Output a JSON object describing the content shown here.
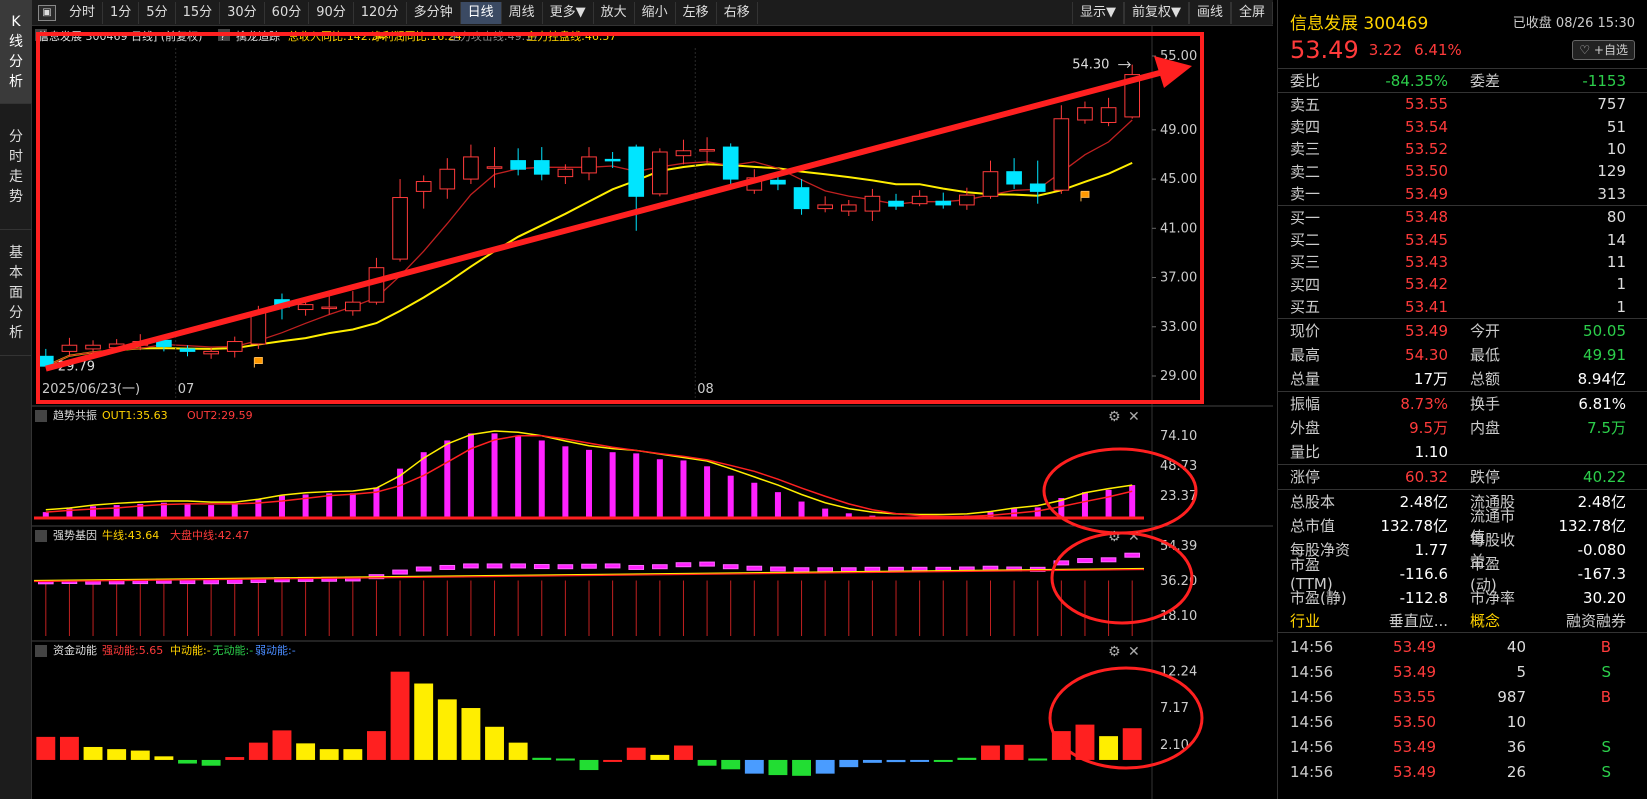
{
  "left_tabs": [
    "K线分析",
    "分时走势",
    "基本面分析"
  ],
  "toolbar": {
    "square_icon": "▣",
    "periods": [
      "分时",
      "1分",
      "5分",
      "15分",
      "30分",
      "60分",
      "90分",
      "120分",
      "多分钟",
      "日线",
      "周线",
      "更多▼",
      "放大",
      "缩小",
      "左移",
      "右移"
    ],
    "active": "日线",
    "right": [
      "显示▼",
      "前复权▼",
      "画线",
      "全屏"
    ]
  },
  "main_chart": {
    "title": "信息发展 300469 日线] (前复权)",
    "help": "?",
    "indicator": "擒龙追踪",
    "items": [
      {
        "label": "总收入同比:142.34",
        "color": "#ffd200"
      },
      {
        "label": "净利润同比:16.24",
        "color": "#ffd200"
      },
      {
        "label": "主力攻击线:49.17",
        "color": "#888888"
      },
      {
        "label": "主力控盘线:46.57",
        "color": "#ffd200"
      }
    ],
    "high_label": "54.30",
    "low_label": "29.79",
    "date_label": "2025/06/23(一)",
    "month_labels": [
      "07",
      "08"
    ],
    "y_ticks": [
      "55.00",
      "49.00",
      "45.00",
      "41.00",
      "37.00",
      "33.00",
      "29.00"
    ]
  },
  "panels": [
    {
      "name": "趋势共振",
      "items": [
        {
          "label": "OUT1:35.63",
          "color": "#ffd200"
        },
        {
          "label": "OUT2:29.59",
          "color": "#ff3b3b"
        }
      ],
      "y_ticks": [
        "74.10",
        "48.73",
        "23.37"
      ]
    },
    {
      "name": "强势基因",
      "items": [
        {
          "label": "牛线:43.64",
          "color": "#ffd200"
        },
        {
          "label": "大盘中线:42.47",
          "color": "#ff3b3b"
        }
      ],
      "y_ticks": [
        "54.39",
        "36.20",
        "18.10"
      ]
    },
    {
      "name": "资金动能",
      "items": [
        {
          "label": "强动能:5.65",
          "color": "#ff3b3b"
        },
        {
          "label": "中动能:-",
          "color": "#ffd200"
        },
        {
          "label": "无动能:-",
          "color": "#2ccf4b"
        },
        {
          "label": "弱动能:-",
          "color": "#4a8cff"
        }
      ],
      "y_ticks": [
        "12.24",
        "7.17",
        "2.10"
      ]
    }
  ],
  "panel_icons": {
    "gear": "⚙",
    "close": "✕"
  },
  "side": {
    "name": "信息发展 300469",
    "status": "已收盘 08/26 15:30",
    "price": "53.49",
    "change": "3.22",
    "pct": "6.41%",
    "watch_btn": "♡ +自选",
    "weibi": {
      "l1": "委比",
      "v1": "-84.35%",
      "l2": "委差",
      "v2": "-1153"
    },
    "asks": [
      {
        "label": "卖五",
        "price": "53.55",
        "vol": "757"
      },
      {
        "label": "卖四",
        "price": "53.54",
        "vol": "51"
      },
      {
        "label": "卖三",
        "price": "53.52",
        "vol": "10"
      },
      {
        "label": "卖二",
        "price": "53.50",
        "vol": "129"
      },
      {
        "label": "卖一",
        "price": "53.49",
        "vol": "313"
      }
    ],
    "bids": [
      {
        "label": "买一",
        "price": "53.48",
        "vol": "80"
      },
      {
        "label": "买二",
        "price": "53.45",
        "vol": "14"
      },
      {
        "label": "买三",
        "price": "53.43",
        "vol": "11"
      },
      {
        "label": "买四",
        "price": "53.42",
        "vol": "1"
      },
      {
        "label": "买五",
        "price": "53.41",
        "vol": "1"
      }
    ],
    "stats1": [
      {
        "l1": "现价",
        "v1": "53.49",
        "c1": "red",
        "l2": "今开",
        "v2": "50.05",
        "c2": "green"
      },
      {
        "l1": "最高",
        "v1": "54.30",
        "c1": "red",
        "l2": "最低",
        "v2": "49.91",
        "c2": "green"
      },
      {
        "l1": "总量",
        "v1": "17万",
        "c1": "white",
        "l2": "总额",
        "v2": "8.94亿",
        "c2": "white"
      }
    ],
    "stats2": [
      {
        "l1": "振幅",
        "v1": "8.73%",
        "c1": "red",
        "l2": "换手",
        "v2": "6.81%",
        "c2": "white"
      },
      {
        "l1": "外盘",
        "v1": "9.5万",
        "c1": "red",
        "l2": "内盘",
        "v2": "7.5万",
        "c2": "green"
      },
      {
        "l1": "量比",
        "v1": "1.10",
        "c1": "white",
        "l2": "",
        "v2": "",
        "c2": "white"
      }
    ],
    "stats3": [
      {
        "l1": "涨停",
        "v1": "60.32",
        "c1": "red",
        "l2": "跌停",
        "v2": "40.22",
        "c2": "green"
      }
    ],
    "stats4": [
      {
        "l1": "总股本",
        "v1": "2.48亿",
        "c1": "white",
        "l2": "流通股",
        "v2": "2.48亿",
        "c2": "white"
      },
      {
        "l1": "总市值",
        "v1": "132.78亿",
        "c1": "white",
        "l2": "流通市值",
        "v2": "132.78亿",
        "c2": "white"
      },
      {
        "l1": "每股净资",
        "v1": "1.77",
        "c1": "white",
        "l2": "每股收益",
        "v2": "-0.080",
        "c2": "white"
      },
      {
        "l1": "市盈(TTM)",
        "v1": "-116.6",
        "c1": "white",
        "l2": "市盈(动)",
        "v2": "-167.3",
        "c2": "white"
      },
      {
        "l1": "市盈(静)",
        "v1": "-112.8",
        "c1": "white",
        "l2": "市净率",
        "v2": "30.20",
        "c2": "white"
      }
    ],
    "industry": {
      "label": "行业",
      "value": "垂直应...",
      "concept": "概念",
      "margin": "融资融券"
    },
    "ticks": [
      {
        "time": "14:56",
        "price": "53.49",
        "vol": "40",
        "dir": "B"
      },
      {
        "time": "14:56",
        "price": "53.49",
        "vol": "5",
        "dir": "S"
      },
      {
        "time": "14:56",
        "price": "53.55",
        "vol": "987",
        "dir": "B"
      },
      {
        "time": "14:56",
        "price": "53.50",
        "vol": "10",
        "dir": ""
      },
      {
        "time": "14:56",
        "price": "53.49",
        "vol": "36",
        "dir": "S"
      },
      {
        "time": "14:56",
        "price": "53.49",
        "vol": "26",
        "dir": "S"
      }
    ]
  },
  "chart_data": [
    {
      "type": "candlestick",
      "ylim": [
        29,
        55
      ],
      "candles": [
        {
          "o": 30.6,
          "c": 29.8,
          "h": 31.2,
          "l": 29.8
        },
        {
          "o": 31.0,
          "c": 31.5,
          "h": 32.1,
          "l": 30.6
        },
        {
          "o": 31.2,
          "c": 31.5,
          "h": 31.9,
          "l": 30.9
        },
        {
          "o": 31.3,
          "c": 31.6,
          "h": 32.0,
          "l": 31.0
        },
        {
          "o": 31.5,
          "c": 31.8,
          "h": 32.4,
          "l": 31.1
        },
        {
          "o": 31.9,
          "c": 31.4,
          "h": 32.2,
          "l": 31.0
        },
        {
          "o": 31.2,
          "c": 31.0,
          "h": 31.5,
          "l": 30.6
        },
        {
          "o": 30.8,
          "c": 31.0,
          "h": 31.3,
          "l": 30.4
        },
        {
          "o": 31.0,
          "c": 31.8,
          "h": 32.2,
          "l": 30.5
        },
        {
          "o": 31.6,
          "c": 34.2,
          "h": 34.7,
          "l": 31.2
        },
        {
          "o": 35.2,
          "c": 34.6,
          "h": 35.7,
          "l": 33.6
        },
        {
          "o": 34.4,
          "c": 34.8,
          "h": 35.3,
          "l": 33.9
        },
        {
          "o": 34.6,
          "c": 34.6,
          "h": 35.5,
          "l": 34.0
        },
        {
          "o": 34.3,
          "c": 35.0,
          "h": 35.9,
          "l": 33.9
        },
        {
          "o": 35.0,
          "c": 37.8,
          "h": 38.6,
          "l": 34.8
        },
        {
          "o": 38.5,
          "c": 43.5,
          "h": 45.0,
          "l": 38.3
        },
        {
          "o": 44.0,
          "c": 44.8,
          "h": 45.3,
          "l": 42.6
        },
        {
          "o": 44.2,
          "c": 45.8,
          "h": 46.7,
          "l": 43.4
        },
        {
          "o": 45.0,
          "c": 46.8,
          "h": 47.8,
          "l": 44.6
        },
        {
          "o": 46.0,
          "c": 46.0,
          "h": 47.6,
          "l": 44.3
        },
        {
          "o": 46.5,
          "c": 45.8,
          "h": 47.5,
          "l": 45.3
        },
        {
          "o": 46.5,
          "c": 45.4,
          "h": 47.6,
          "l": 44.9
        },
        {
          "o": 45.2,
          "c": 45.8,
          "h": 46.2,
          "l": 44.6
        },
        {
          "o": 45.5,
          "c": 46.8,
          "h": 47.6,
          "l": 44.9
        },
        {
          "o": 46.6,
          "c": 46.5,
          "h": 47.2,
          "l": 45.9
        },
        {
          "o": 47.6,
          "c": 43.6,
          "h": 47.8,
          "l": 40.8
        },
        {
          "o": 43.8,
          "c": 47.2,
          "h": 47.5,
          "l": 43.6
        },
        {
          "o": 46.9,
          "c": 47.3,
          "h": 48.2,
          "l": 46.2
        },
        {
          "o": 47.4,
          "c": 47.4,
          "h": 48.4,
          "l": 46.2
        },
        {
          "o": 47.6,
          "c": 45.0,
          "h": 47.9,
          "l": 44.5
        },
        {
          "o": 44.1,
          "c": 45.1,
          "h": 45.8,
          "l": 43.8
        },
        {
          "o": 44.9,
          "c": 44.6,
          "h": 45.3,
          "l": 44.1
        },
        {
          "o": 44.3,
          "c": 42.6,
          "h": 45.0,
          "l": 42.1
        },
        {
          "o": 42.6,
          "c": 42.9,
          "h": 43.6,
          "l": 42.3
        },
        {
          "o": 42.4,
          "c": 42.9,
          "h": 43.3,
          "l": 42.0
        },
        {
          "o": 42.4,
          "c": 43.6,
          "h": 44.2,
          "l": 41.6
        },
        {
          "o": 43.2,
          "c": 42.8,
          "h": 43.8,
          "l": 42.5
        },
        {
          "o": 43.0,
          "c": 43.6,
          "h": 44.1,
          "l": 42.8
        },
        {
          "o": 43.2,
          "c": 42.9,
          "h": 43.9,
          "l": 42.6
        },
        {
          "o": 42.9,
          "c": 43.7,
          "h": 44.3,
          "l": 42.5
        },
        {
          "o": 43.6,
          "c": 45.6,
          "h": 46.5,
          "l": 43.4
        },
        {
          "o": 45.6,
          "c": 44.6,
          "h": 46.7,
          "l": 44.2
        },
        {
          "o": 44.6,
          "c": 44.0,
          "h": 46.5,
          "l": 43.0
        },
        {
          "o": 44.1,
          "c": 49.9,
          "h": 51.0,
          "l": 43.8
        },
        {
          "o": 49.8,
          "c": 50.8,
          "h": 51.3,
          "l": 49.5
        },
        {
          "o": 49.6,
          "c": 50.8,
          "h": 51.6,
          "l": 49.3
        },
        {
          "o": 50.05,
          "c": 53.49,
          "h": 54.3,
          "l": 49.91
        }
      ]
    },
    {
      "type": "bar",
      "name": "趋势共振",
      "ylim": [
        0,
        80
      ],
      "values": [
        5,
        8,
        10,
        11,
        12,
        13,
        12,
        11,
        12,
        16,
        19,
        20,
        21,
        21,
        26,
        42,
        56,
        66,
        72,
        72,
        70,
        66,
        61,
        58,
        56,
        55,
        50,
        49,
        44,
        36,
        30,
        22,
        14,
        8,
        4,
        2,
        1,
        1,
        1,
        2,
        5,
        8,
        9,
        17,
        22,
        24,
        28
      ]
    },
    {
      "type": "bar",
      "name": "强势基因",
      "ylim": [
        0,
        60
      ],
      "values": [
        36.0,
        36.2,
        36.4,
        36.6,
        36.8,
        37.0,
        36.8,
        36.7,
        36.9,
        37.5,
        38.0,
        38.2,
        38.3,
        38.5,
        40.0,
        43.0,
        45.0,
        46.0,
        47.0,
        47.0,
        47.0,
        46.6,
        46.5,
        46.8,
        47.0,
        46.0,
        46.5,
        47.8,
        48.2,
        46.5,
        45.5,
        45.0,
        44.5,
        44.5,
        44.5,
        44.8,
        44.8,
        44.8,
        44.8,
        45.0,
        45.5,
        45.0,
        44.8,
        49.0,
        50.5,
        51.0,
        54.0
      ]
    },
    {
      "type": "bar",
      "name": "资金动能",
      "ylim": [
        -5,
        14
      ],
      "values": [
        3.2,
        3.2,
        1.8,
        1.5,
        1.3,
        0.5,
        -0.5,
        -0.8,
        0.4,
        2.4,
        4.1,
        2.3,
        1.5,
        1.5,
        4.0,
        12.24,
        10.6,
        8.4,
        7.2,
        4.6,
        2.4,
        0.3,
        0.2,
        -1.4,
        -0.2,
        1.7,
        0.7,
        2.0,
        -0.8,
        -1.3,
        -1.9,
        -2.1,
        -2.2,
        -1.9,
        -1.0,
        -0.4,
        -0.3,
        -0.2,
        -0.2,
        0.3,
        2.0,
        2.1,
        0.2,
        4.0,
        4.9,
        3.3,
        4.4
      ],
      "colors": [
        "red",
        "red",
        "yellow",
        "yellow",
        "yellow",
        "yellow",
        "green",
        "green",
        "red",
        "red",
        "red",
        "yellow",
        "yellow",
        "yellow",
        "red",
        "red",
        "yellow",
        "yellow",
        "yellow",
        "yellow",
        "yellow",
        "green",
        "green",
        "green",
        "red",
        "red",
        "yellow",
        "red",
        "green",
        "green",
        "blue",
        "green",
        "green",
        "blue",
        "blue",
        "blue",
        "blue",
        "blue",
        "green",
        "green",
        "red",
        "red",
        "green",
        "red",
        "red",
        "yellow",
        "red"
      ]
    }
  ]
}
